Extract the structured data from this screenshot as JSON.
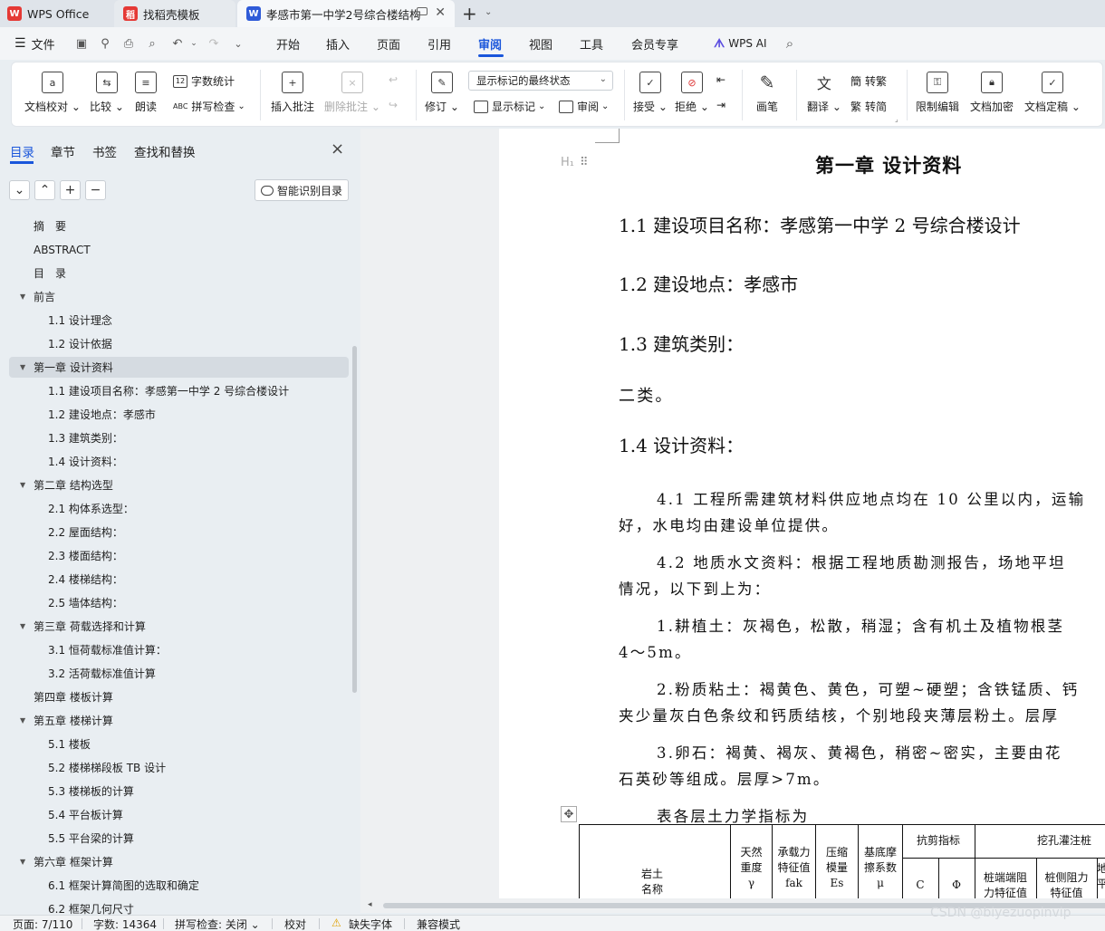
{
  "tabs": {
    "app": "WPS Office",
    "template": "找稻壳模板",
    "document": "孝感市第一中学2号综合楼结构",
    "new_tab": "+",
    "new_tab_menu": "⌄",
    "close_icon": "✕"
  },
  "menu": {
    "file": "文件",
    "items": [
      "开始",
      "插入",
      "页面",
      "引用",
      "审阅",
      "视图",
      "工具",
      "会员专享"
    ],
    "active": "审阅",
    "wps_ai": "WPS AI"
  },
  "ribbon": {
    "doc_check": "文档校对",
    "compare": "比较",
    "read_aloud": "朗读",
    "word_count": "字数统计",
    "spell_check": "拼写检查",
    "insert_comment": "插入批注",
    "delete_comment": "删除批注",
    "revise": "修订",
    "markup_select": "显示标记的最终状态",
    "show_markup": "显示标记",
    "review": "审阅",
    "accept": "接受",
    "reject": "拒绝",
    "pen": "画笔",
    "translate": "翻译",
    "to_traditional": "转繁",
    "to_simplified": "转简",
    "restrict_edit": "限制编辑",
    "encrypt": "文档加密",
    "finalize": "文档定稿"
  },
  "sidebar": {
    "tabs": [
      "目录",
      "章节",
      "书签",
      "查找和替换"
    ],
    "active_tab": "目录",
    "buttons": {
      "collapse": "⌄",
      "expand": "⌃",
      "add": "+",
      "remove": "−"
    },
    "smart_toc": "智能识别目录",
    "toc": [
      {
        "label": "摘　要",
        "level": 0,
        "arrow": false
      },
      {
        "label": "ABSTRACT",
        "level": 0,
        "arrow": false
      },
      {
        "label": "目　录",
        "level": 0,
        "arrow": false
      },
      {
        "label": "前言",
        "level": 0,
        "arrow": true
      },
      {
        "label": "1.1 设计理念",
        "level": 1,
        "arrow": false
      },
      {
        "label": "1.2 设计依据",
        "level": 1,
        "arrow": false
      },
      {
        "label": "第一章  设计资料",
        "level": 0,
        "arrow": true,
        "selected": true
      },
      {
        "label": "1.1 建设项目名称：孝感第一中学 2 号综合楼设计",
        "level": 1,
        "arrow": false
      },
      {
        "label": "1.2 建设地点：孝感市",
        "level": 1,
        "arrow": false
      },
      {
        "label": "1.3 建筑类别：",
        "level": 1,
        "arrow": false
      },
      {
        "label": "1.4 设计资料：",
        "level": 1,
        "arrow": false
      },
      {
        "label": "第二章  结构选型",
        "level": 0,
        "arrow": true
      },
      {
        "label": "2.1 构体系选型：",
        "level": 1,
        "arrow": false
      },
      {
        "label": "2.2 屋面结构：",
        "level": 1,
        "arrow": false
      },
      {
        "label": "2.3 楼面结构：",
        "level": 1,
        "arrow": false
      },
      {
        "label": "2.4 楼梯结构：",
        "level": 1,
        "arrow": false
      },
      {
        "label": "2.5 墙体结构：",
        "level": 1,
        "arrow": false
      },
      {
        "label": "第三章  荷载选择和计算",
        "level": 0,
        "arrow": true
      },
      {
        "label": "3.1 恒荷载标准值计算：",
        "level": 1,
        "arrow": false
      },
      {
        "label": "3.2 活荷载标准值计算",
        "level": 1,
        "arrow": false
      },
      {
        "label": "第四章  楼板计算",
        "level": 0,
        "arrow": false
      },
      {
        "label": "第五章  楼梯计算",
        "level": 0,
        "arrow": true
      },
      {
        "label": "5.1 楼板",
        "level": 1,
        "arrow": false
      },
      {
        "label": "5.2 楼梯梯段板 TB 设计",
        "level": 1,
        "arrow": false
      },
      {
        "label": "5.3 楼梯板的计算",
        "level": 1,
        "arrow": false
      },
      {
        "label": "5.4 平台板计算",
        "level": 1,
        "arrow": false
      },
      {
        "label": "5.5 平台梁的计算",
        "level": 1,
        "arrow": false
      },
      {
        "label": "第六章  框架计算",
        "level": 0,
        "arrow": true
      },
      {
        "label": "6.1 框架计算简图的选取和确定",
        "level": 1,
        "arrow": false
      },
      {
        "label": "6.2 框架几何尺寸",
        "level": 1,
        "arrow": false
      }
    ]
  },
  "document": {
    "heading_marker": "H₁",
    "chapter": "第一章  设计资料",
    "h1": "1.1 建设项目名称：孝感第一中学 2 号综合楼设计",
    "h2": "1.2 建设地点：孝感市",
    "h3": "1.3 建筑类别：",
    "p_class": "二类。",
    "h4": "1.4 设计资料：",
    "p1a": "4.1 工程所需建筑材料供应地点均在 10 公里以内，运输",
    "p1b": "好，水电均由建设单位提供。",
    "p2a": "4.2 地质水文资料：根据工程地质勘测报告，场地平坦",
    "p2b": "情况，以下到上为：",
    "p3a": "1.耕植土：灰褐色，松散，稍湿；含有机土及植物根茎",
    "p3b": "4～5m。",
    "p4a": "2.粉质粘土：褐黄色、黄色，可塑~硬塑；含铁锰质、钙",
    "p4b": "夹少量灰白色条纹和钙质结核，个别地段夹薄层粉土。层厚",
    "p5a": "3.卵石：褐黄、褐灰、黄褐色，稍密~密实，主要由花",
    "p5b": "石英砂等组成。层厚>7m。",
    "table_caption": "表各层土力学指标为",
    "table_headers": {
      "soil": "岩土\n名称",
      "unit_weight": "天然\n重度\nγ",
      "bearing": "承载力\n特征值\nfak",
      "modulus": "压缩\n模量\nEs",
      "friction": "基底摩\n擦系数\nμ",
      "shear": "抗剪指标",
      "c": "C",
      "phi": "Φ",
      "pile": "挖孔灌注桩",
      "tip": "桩端端阻\n力特征值",
      "side": "桩侧阻力\n特征值",
      "next": "地\n平"
    }
  },
  "status": {
    "page": "页面: 7/110",
    "words": "字数: 14364",
    "spell": "拼写检查: 关闭",
    "proof": "校对",
    "missing_font": "缺失字体",
    "compat": "兼容模式"
  },
  "watermark": "CSDN @biyezuopinvip"
}
